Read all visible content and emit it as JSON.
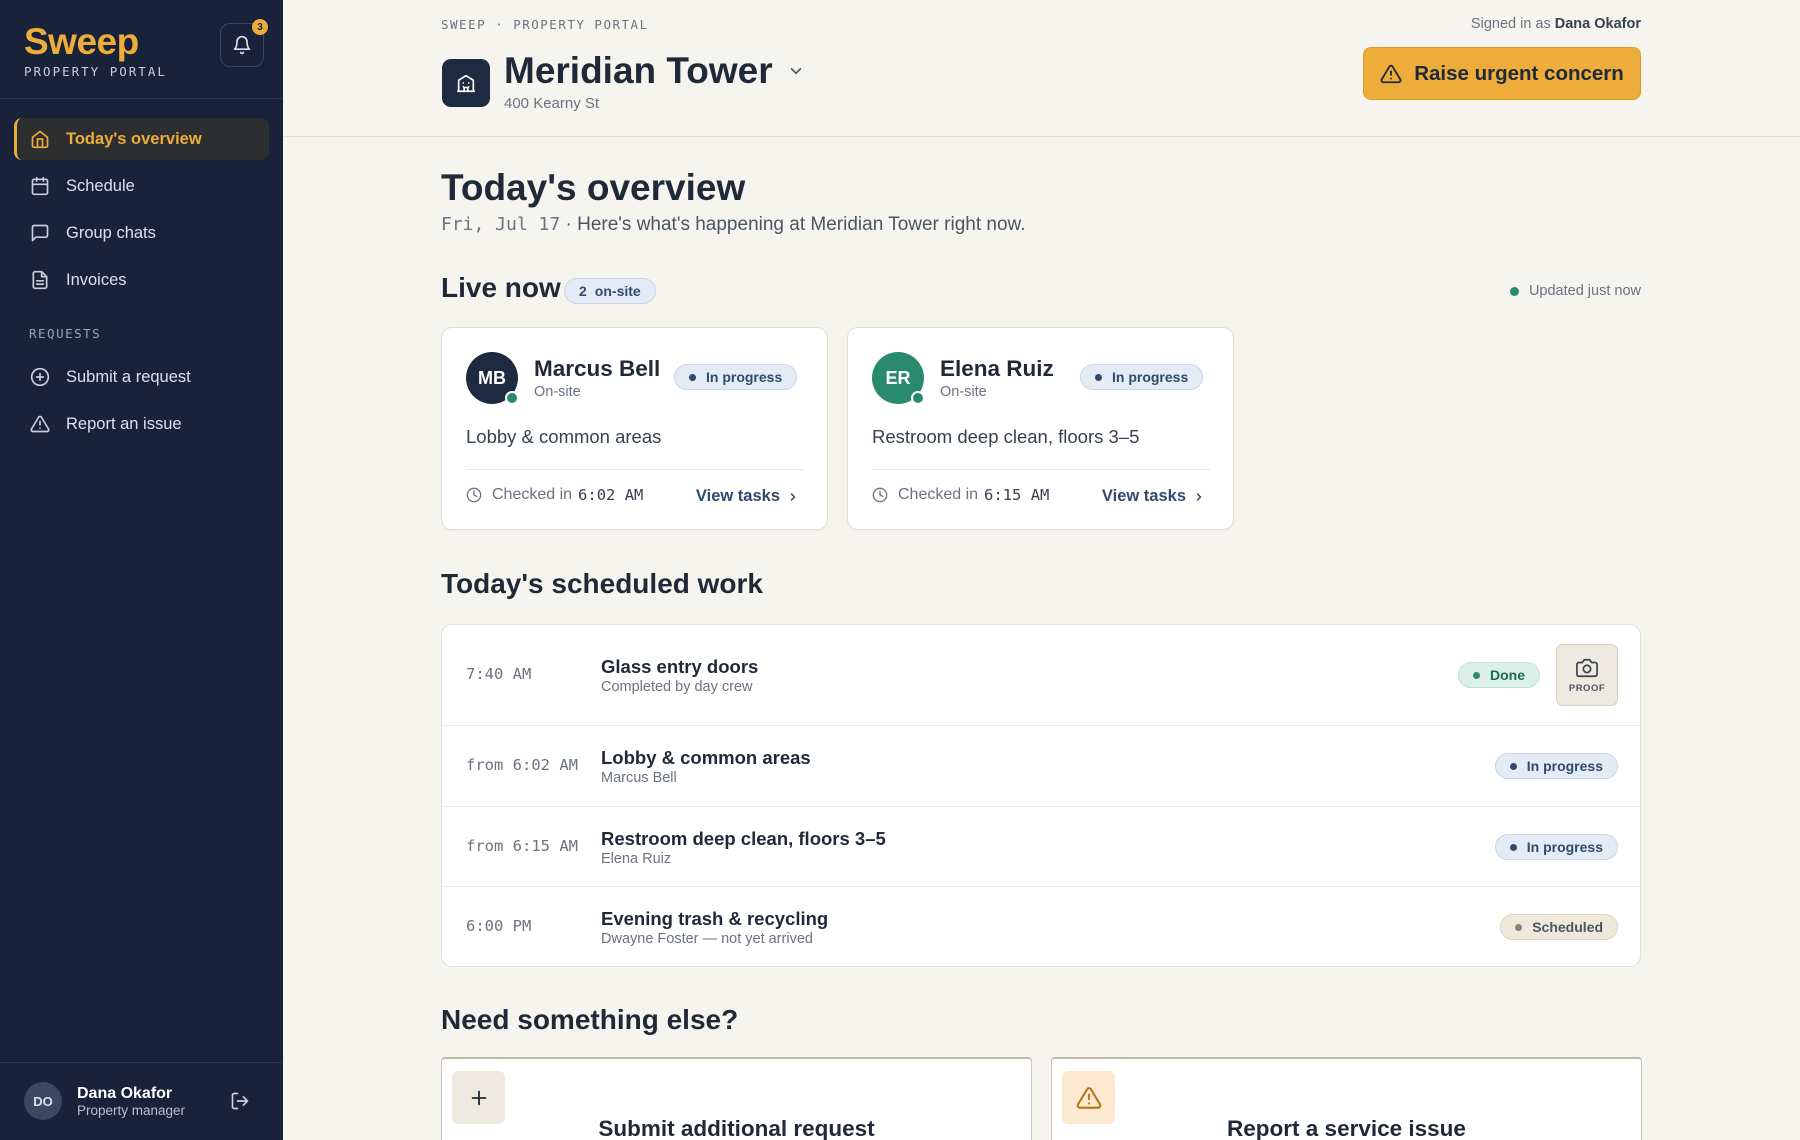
{
  "sidebar": {
    "brand": "Sweep",
    "brand_sub": "PROPERTY PORTAL",
    "notification_count": "3",
    "nav": [
      {
        "label": "Today's overview",
        "icon": "home-icon",
        "active": true
      },
      {
        "label": "Schedule",
        "icon": "calendar-icon"
      },
      {
        "label": "Group chats",
        "icon": "chat-icon"
      },
      {
        "label": "Invoices",
        "icon": "document-icon"
      }
    ],
    "requests_heading": "REQUESTS",
    "requests": [
      {
        "label": "Submit a request",
        "icon": "plus-circle-icon"
      },
      {
        "label": "Report an issue",
        "icon": "warning-icon"
      }
    ],
    "user": {
      "initials": "DO",
      "name": "Dana Okafor",
      "role": "Property manager"
    }
  },
  "header": {
    "breadcrumb": "SWEEP · PROPERTY PORTAL",
    "signed_in_prefix": "Signed in as",
    "signed_in_name": "Dana Okafor",
    "building_name": "Meridian Tower",
    "building_address": "400 Kearny St",
    "urgent_label": "Raise urgent concern"
  },
  "overview": {
    "title": "Today's overview",
    "date": "Fri, Jul 17",
    "subtitle": " · Here's what's happening at Meridian Tower right now."
  },
  "live": {
    "title": "Live now",
    "count": "2",
    "count_label": "on-site",
    "updated": "Updated just now",
    "cards": [
      {
        "initials": "MB",
        "avatar_color": "#1e2a3f",
        "name": "Marcus Bell",
        "state": "On-site",
        "status": "In progress",
        "task": "Lobby & common areas",
        "checked_label": "Checked in",
        "checked_time": "6:02 AM",
        "view_label": "View tasks"
      },
      {
        "initials": "ER",
        "avatar_color": "#2a8a6e",
        "name": "Elena Ruiz",
        "state": "On-site",
        "status": "In progress",
        "task": "Restroom deep clean, floors 3–5",
        "checked_label": "Checked in",
        "checked_time": "6:15 AM",
        "view_label": "View tasks"
      }
    ]
  },
  "schedule": {
    "title": "Today's scheduled work",
    "rows": [
      {
        "time": "7:40 AM",
        "title": "Glass entry doors",
        "sub": "Completed by day crew",
        "status": "Done",
        "status_kind": "done",
        "proof_label": "PROOF"
      },
      {
        "time": "from 6:02 AM",
        "title": "Lobby & common areas",
        "sub": "Marcus Bell",
        "status": "In progress",
        "status_kind": "prog"
      },
      {
        "time": "from 6:15 AM",
        "title": "Restroom deep clean, floors 3–5",
        "sub": "Elena Ruiz",
        "status": "In progress",
        "status_kind": "prog"
      },
      {
        "time": "6:00 PM",
        "title": "Evening trash & recycling",
        "sub": "Dwayne Foster — not yet arrived",
        "status": "Scheduled",
        "status_kind": "sched"
      }
    ]
  },
  "else": {
    "title": "Need something else?",
    "cards": [
      {
        "title": "Submit additional request",
        "icon": "plus-icon"
      },
      {
        "title": "Report a service issue",
        "icon": "warning-icon"
      }
    ]
  }
}
